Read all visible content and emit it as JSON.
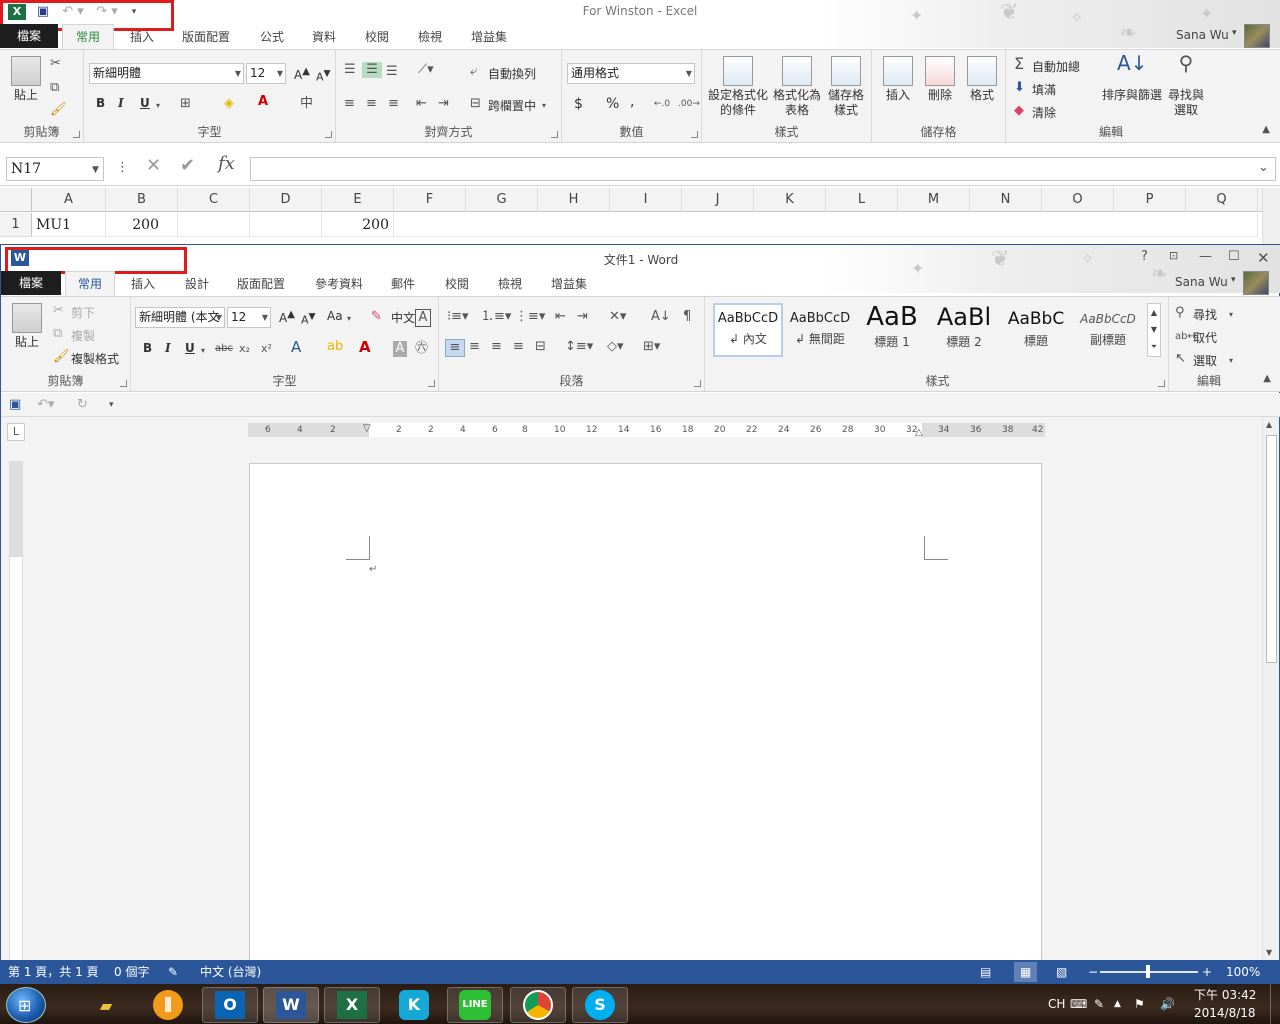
{
  "excel": {
    "window_title": "For Winston - Excel",
    "user": "Sana Wu",
    "tabs": [
      "檔案",
      "常用",
      "插入",
      "版面配置",
      "公式",
      "資料",
      "校閱",
      "檢視",
      "增益集"
    ],
    "active_tab": "常用",
    "ribbon": {
      "clipboard": {
        "paste": "貼上",
        "label": "剪貼簿"
      },
      "font": {
        "name": "新細明體",
        "size": "12",
        "label": "字型",
        "bold": "B",
        "italic": "I",
        "underline": "U"
      },
      "alignment": {
        "wrap": "自動換列",
        "merge": "跨欄置中",
        "label": "對齊方式"
      },
      "number": {
        "format": "通用格式",
        "currency": "$",
        "percent": "%",
        "comma": ",",
        "label": "數值"
      },
      "styles": {
        "conditional": "設定格式化的條件",
        "table": "格式化為表格",
        "cell": "儲存格樣式",
        "label": "樣式"
      },
      "cells": {
        "insert": "插入",
        "delete": "刪除",
        "format": "格式",
        "label": "儲存格"
      },
      "editing": {
        "autosum": "自動加總",
        "fill": "填滿",
        "clear": "清除",
        "sort": "排序與篩選",
        "find": "尋找與選取",
        "label": "編輯"
      }
    },
    "name_box": "N17",
    "formula": "",
    "columns": [
      "A",
      "B",
      "C",
      "D",
      "E",
      "F",
      "G",
      "H",
      "I",
      "J",
      "K",
      "L",
      "M",
      "N",
      "O",
      "P",
      "Q"
    ],
    "rows": [
      {
        "num": "1",
        "A": "MU1",
        "B": "200",
        "E": "200"
      }
    ]
  },
  "word": {
    "window_title": "文件1 - Word",
    "user": "Sana Wu",
    "tabs": [
      "檔案",
      "常用",
      "插入",
      "設計",
      "版面配置",
      "參考資料",
      "郵件",
      "校閱",
      "檢視",
      "增益集"
    ],
    "active_tab": "常用",
    "ribbon": {
      "clipboard": {
        "paste": "貼上",
        "cut": "剪下",
        "copy": "複製",
        "format_painter": "複製格式",
        "label": "剪貼簿"
      },
      "font": {
        "name": "新細明體 (本文",
        "size": "12",
        "label": "字型",
        "case": "Aa",
        "phonetic": "中文"
      },
      "paragraph": {
        "label": "段落"
      },
      "styles": {
        "label": "樣式",
        "items": [
          {
            "preview": "AaBbCcD",
            "name": "內文"
          },
          {
            "preview": "AaBbCcD",
            "name": "無間距"
          },
          {
            "preview": "AaB",
            "name": "標題 1"
          },
          {
            "preview": "AaBl",
            "name": "標題 2"
          },
          {
            "preview": "AaBbC",
            "name": "標題"
          },
          {
            "preview": "AaBbCcD",
            "name": "副標題"
          }
        ]
      },
      "editing": {
        "find": "尋找",
        "replace": "取代",
        "select": "選取",
        "label": "編輯"
      }
    },
    "ruler_numbers": [
      "6",
      "4",
      "2",
      "2",
      "2",
      "4",
      "6",
      "8",
      "10",
      "12",
      "14",
      "16",
      "18",
      "20",
      "22",
      "24",
      "26",
      "28",
      "30",
      "32",
      "34",
      "36",
      "38",
      "40",
      "42"
    ],
    "status": {
      "page": "第 1 頁，共 1 頁",
      "words": "0 個字",
      "language": "中文 (台灣)",
      "zoom": "100%"
    }
  },
  "taskbar": {
    "ime": "CH",
    "time": "下午 03:42",
    "date": "2014/8/18"
  }
}
